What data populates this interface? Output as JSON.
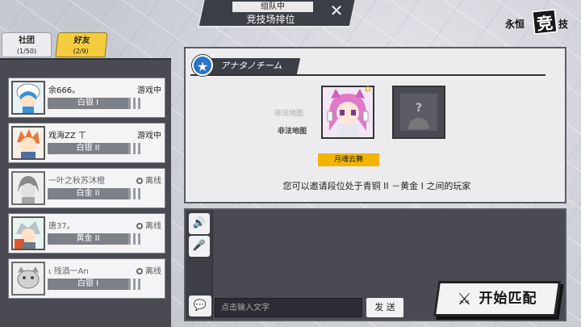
{
  "header": {
    "status": "组队中",
    "mode_title": "竞技场排位",
    "close_icon": "close-icon",
    "logo": {
      "left": "永恒",
      "middle": "竞",
      "right": "技"
    }
  },
  "tabs": [
    {
      "label": "社团",
      "count": "(1/50)"
    },
    {
      "label": "好友",
      "count": "(2/9)",
      "active": true
    }
  ],
  "friends": [
    {
      "name": "余666。",
      "rank": "白银 I",
      "status": "游戏中",
      "online": true
    },
    {
      "name": "戏海ZZ ㄒ",
      "rank": "白银 II",
      "status": "游戏中",
      "online": true
    },
    {
      "name": "一叶之秋苏沐橙",
      "rank": "白金 II",
      "status": "离线",
      "online": false
    },
    {
      "name": "唐37。",
      "rank": "黄金 II",
      "status": "离线",
      "online": false
    },
    {
      "name": "ι 残酒一An",
      "rank": "白银 I",
      "status": "离线",
      "online": false
    }
  ],
  "team": {
    "name": "アナタノチーム",
    "stamp_text": "非法地图",
    "member_name": "月魂云舞",
    "empty_slot_symbol": "?",
    "invite_note": "您可以邀请段位处于青铜 II －黄金 I 之间的玩家"
  },
  "chat": {
    "input_placeholder": "点击输入文字",
    "send_label": "发 送",
    "speaker_icon": "speaker-icon",
    "mic_icon": "microphone-icon",
    "chat_icon": "chat-bubble-icon"
  },
  "match_button": {
    "label": "开始匹配",
    "icon": "crossed-swords-icon"
  },
  "colors": {
    "accent_yellow": "#f5cc3d",
    "panel_dark": "#4a4b52",
    "member_tag": "#f2b400",
    "star_blue": "#2a74c9"
  }
}
